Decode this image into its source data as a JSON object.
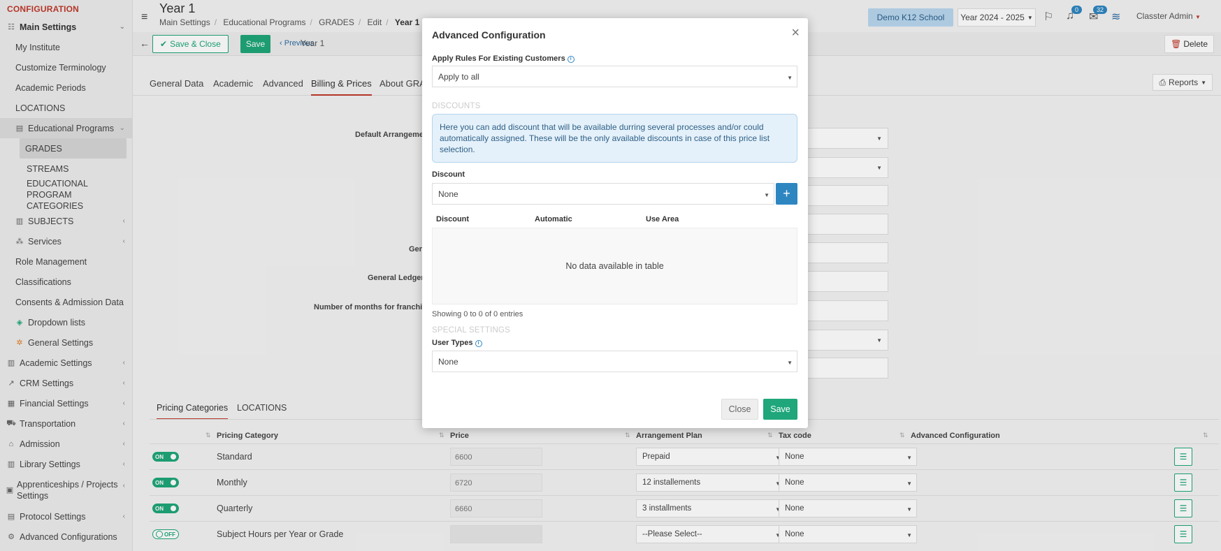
{
  "sidebar": {
    "header": "CONFIGURATION",
    "items": [
      {
        "label": "Main Settings",
        "icon": "sliders-icon"
      },
      {
        "label": "My Institute"
      },
      {
        "label": "Customize Terminology"
      },
      {
        "label": "Academic Periods"
      },
      {
        "label": "LOCATIONS"
      },
      {
        "label": "Educational Programs",
        "icon": "book-icon"
      },
      {
        "label": "GRADES"
      },
      {
        "label": "STREAMS"
      },
      {
        "label": "EDUCATIONAL PROGRAM CATEGORIES"
      },
      {
        "label": "SUBJECTS",
        "icon": "books-icon"
      },
      {
        "label": "Services",
        "icon": "network-icon"
      },
      {
        "label": "Role Management"
      },
      {
        "label": "Classifications"
      },
      {
        "label": "Consents & Admission Data"
      },
      {
        "label": "Dropdown lists",
        "icon": "layers-icon"
      },
      {
        "label": "General Settings",
        "icon": "gear-icon"
      },
      {
        "label": "Academic Settings",
        "icon": "chart-icon"
      },
      {
        "label": "CRM Settings",
        "icon": "crm-icon"
      },
      {
        "label": "Financial Settings",
        "icon": "cash-icon"
      },
      {
        "label": "Transportation",
        "icon": "bus-icon"
      },
      {
        "label": "Admission",
        "icon": "building-icon"
      },
      {
        "label": "Library Settings",
        "icon": "library-icon"
      },
      {
        "label": "Apprenticeships / Projects Settings",
        "icon": "briefcase-icon"
      },
      {
        "label": "Protocol Settings",
        "icon": "protocol-icon"
      },
      {
        "label": "Advanced Configurations",
        "icon": "cogs-icon"
      }
    ]
  },
  "header": {
    "title": "Year 1",
    "breadcrumb": [
      "Main Settings",
      "Educational Programs",
      "GRADES",
      "Edit",
      "Year 1"
    ],
    "school": "Demo K12 School",
    "year": "Year 2024 - 2025",
    "notifications_count": "0",
    "messages_count": "32",
    "user": "Classter Admin"
  },
  "toolbar": {
    "save_close": "Save & Close",
    "save": "Save",
    "previous": "Previous",
    "record": "Year 1",
    "delete": "Delete"
  },
  "tabs": [
    "General Data",
    "Academic",
    "Advanced",
    "Billing & Prices",
    "About GRA"
  ],
  "reports": "Reports",
  "form_labels": {
    "default_arrangement": "Default Arrangeme",
    "gen": "Gen",
    "general_ledger": "General Ledger",
    "franchise": "Number of months for franchi"
  },
  "subtabs": [
    "Pricing Categories",
    "LOCATIONS"
  ],
  "pricing_table": {
    "headers": [
      "Pricing Category",
      "Price",
      "Arrangement Plan",
      "Tax code",
      "Advanced Configuration"
    ],
    "rows": [
      {
        "toggle": "ON",
        "name": "Standard",
        "price": "6600",
        "plan": "Prepaid",
        "tax": "None"
      },
      {
        "toggle": "ON",
        "name": "Monthly",
        "price": "6720",
        "plan": "12 installements",
        "tax": "None"
      },
      {
        "toggle": "ON",
        "name": "Quarterly",
        "price": "6660",
        "plan": "3 installments",
        "tax": "None"
      },
      {
        "toggle": "OFF",
        "name": "Subject Hours per Year or Grade",
        "price": "",
        "plan": "--Please Select--",
        "tax": "None"
      }
    ]
  },
  "modal": {
    "title": "Advanced Configuration",
    "apply_rules_label": "Apply Rules For Existing Customers",
    "apply_rules_value": "Apply to all",
    "discounts_section": "DISCOUNTS",
    "discount_info": "Here you can add discount that will be available durring several processes and/or could automatically assigned. These will be the only available discounts in case of this price list selection.",
    "discount_label": "Discount",
    "discount_value": "None",
    "table_headers": [
      "Discount",
      "Automatic",
      "Use Area"
    ],
    "empty_text": "No data available in table",
    "entries_info": "Showing 0 to 0 of 0 entries",
    "special_section": "SPECIAL SETTINGS",
    "user_types_label": "User Types",
    "user_types_value": "None",
    "close_label": "Close",
    "save_label": "Save"
  },
  "colors": {
    "accent_green": "#1fa67a",
    "accent_red": "#c0392b",
    "accent_blue": "#2e86c1"
  }
}
